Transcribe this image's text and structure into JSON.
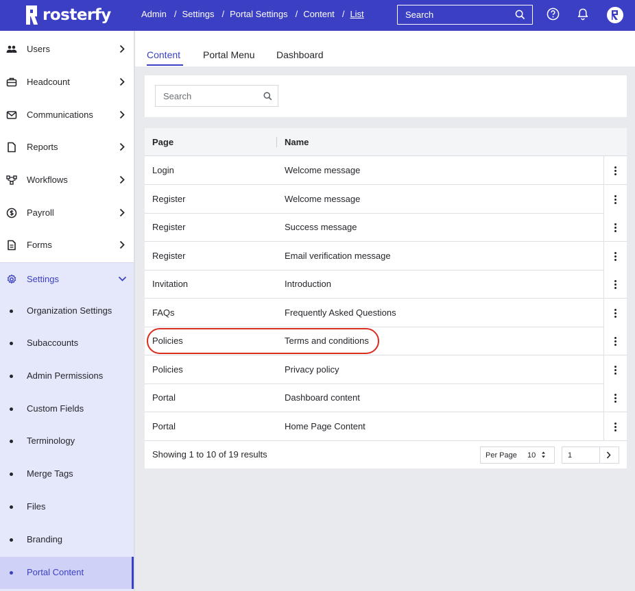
{
  "brand": {
    "name": "rosterfy",
    "accent": "#3a3fc4",
    "highlight_color": "#d92d20"
  },
  "breadcrumb": [
    "Admin",
    "Settings",
    "Portal Settings",
    "Content",
    "List"
  ],
  "header": {
    "search_placeholder": "Search"
  },
  "sidebar": {
    "items": [
      {
        "label": "Users",
        "icon": "users-icon"
      },
      {
        "label": "Headcount",
        "icon": "briefcase-icon"
      },
      {
        "label": "Communications",
        "icon": "mail-icon"
      },
      {
        "label": "Reports",
        "icon": "document-icon"
      },
      {
        "label": "Workflows",
        "icon": "workflow-icon"
      },
      {
        "label": "Payroll",
        "icon": "dollar-icon"
      },
      {
        "label": "Forms",
        "icon": "form-icon"
      }
    ],
    "settings": {
      "label": "Settings",
      "sub_items": [
        "Organization Settings",
        "Subaccounts",
        "Admin Permissions",
        "Custom Fields",
        "Terminology",
        "Merge Tags",
        "Files",
        "Branding",
        "Portal Content"
      ],
      "active": "Portal Content"
    }
  },
  "tabs": [
    "Content",
    "Portal Menu",
    "Dashboard"
  ],
  "active_tab": "Content",
  "content_search": {
    "placeholder": "Search"
  },
  "table": {
    "columns": [
      "Page",
      "Name"
    ],
    "rows": [
      [
        "Login",
        "Welcome message"
      ],
      [
        "Register",
        "Welcome message"
      ],
      [
        "Register",
        "Success message"
      ],
      [
        "Register",
        "Email verification message"
      ],
      [
        "Invitation",
        "Introduction"
      ],
      [
        "FAQs",
        "Frequently Asked Questions"
      ],
      [
        "Policies",
        "Terms and conditions"
      ],
      [
        "Policies",
        "Privacy policy"
      ],
      [
        "Portal",
        "Dashboard content"
      ],
      [
        "Portal",
        "Home Page Content"
      ]
    ],
    "highlighted_row": 6
  },
  "footer": {
    "summary": "Showing 1 to 10 of 19 results",
    "per_page_label": "Per Page",
    "per_page_value": "10",
    "page_value": "1"
  }
}
